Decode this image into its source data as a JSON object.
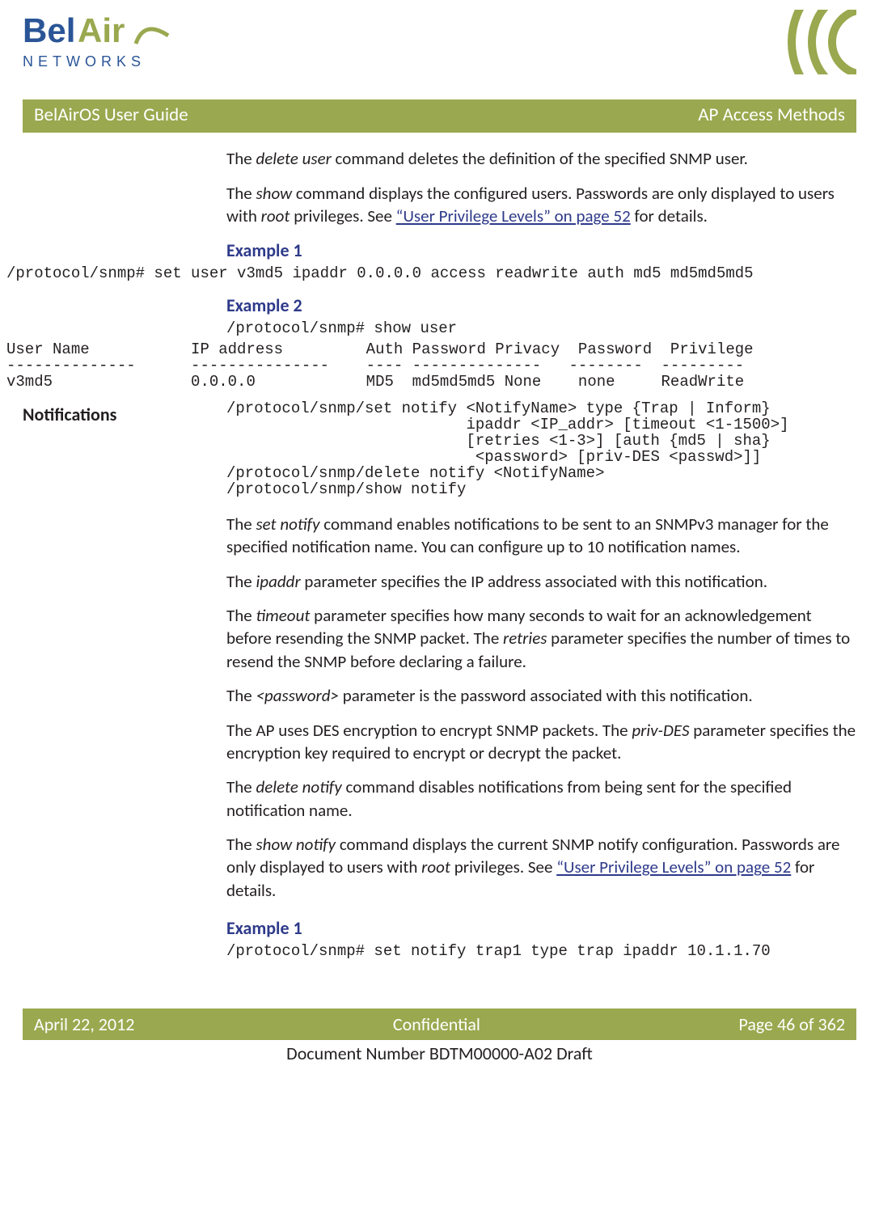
{
  "header": {
    "brand_top": "BelAir",
    "brand_bottom": "N E T W O R K S",
    "doc_title": "BelAirOS User Guide",
    "section": "AP Access Methods"
  },
  "body": {
    "p1_pre": "The ",
    "p1_cmd": "delete user",
    "p1_post": " command deletes the definition of the specified SNMP user.",
    "p2_pre": "The ",
    "p2_cmd": "show",
    "p2_mid": " command displays the configured users. Passwords are only displayed to users with ",
    "p2_root": "root",
    "p2_mid2": " privileges. See ",
    "p2_link": "“User Privilege Levels” on page 52",
    "p2_post": " for details.",
    "ex1_head": "Example 1",
    "ex1_code": "/protocol/snmp# set user v3md5 ipaddr 0.0.0.0 access readwrite auth md5 md5md5md5",
    "ex2_head": "Example 2",
    "ex2_code": "/protocol/snmp# show user",
    "ex2_table": "User Name           IP address         Auth Password Privacy  Password  Privilege\n--------------      ---------------    ---- --------------   --------  ---------\nv3md5               0.0.0.0            MD5  md5md5md5 None    none     ReadWrite",
    "notify_head": "Notifications",
    "notify_syntax": "/protocol/snmp/set notify <NotifyName> type {Trap | Inform}\n                          ipaddr <IP_addr> [timeout <1-1500>]\n                          [retries <1-3>] [auth {md5 | sha}\n                           <password> [priv-DES <passwd>]]\n/protocol/snmp/delete notify <NotifyName>\n/protocol/snmp/show notify",
    "np1_pre": "The ",
    "np1_cmd": "set notify",
    "np1_post": " command enables notifications to be sent to an SNMPv3 manager for the specified notification name. You can configure up to 10 notification names.",
    "np2_pre": "The ",
    "np2_cmd": "ipaddr",
    "np2_post": " parameter specifies the IP address associated with this notification.",
    "np3_pre": "The ",
    "np3_cmd": "timeout",
    "np3_mid": " parameter specifies how many seconds to wait for an acknowledgement before resending the SNMP packet. The ",
    "np3_cmd2": "retries",
    "np3_post": " parameter specifies the number of times to resend the SNMP before declaring a failure.",
    "np4_pre": "The ",
    "np4_cmd": "<password>",
    "np4_post": " parameter is the password associated with this notification.",
    "np5_pre": "The AP uses DES encryption to encrypt SNMP packets. The ",
    "np5_cmd": "priv-DES",
    "np5_post": " parameter specifies the encryption key required to encrypt or decrypt the packet.",
    "np6_pre": "The ",
    "np6_cmd": "delete notify",
    "np6_post": " command disables notifications from being sent for the specified notification name.",
    "np7_pre": "The ",
    "np7_cmd": "show notify",
    "np7_mid": " command displays the current SNMP notify configuration. Passwords are only displayed to users with ",
    "np7_root": "root",
    "np7_mid2": " privileges. See ",
    "np7_link": "“User Privilege Levels” on page 52",
    "np7_post": " for details.",
    "nex1_head": "Example 1",
    "nex1_code": "/protocol/snmp# set notify trap1 type trap ipaddr 10.1.1.70"
  },
  "footer": {
    "date": "April 22, 2012",
    "conf": "Confidential",
    "page": "Page 46 of 362",
    "docnum": "Document Number BDTM00000-A02 Draft"
  },
  "colors": {
    "accent": "#2e3a8a",
    "bar": "#9aa84f"
  }
}
